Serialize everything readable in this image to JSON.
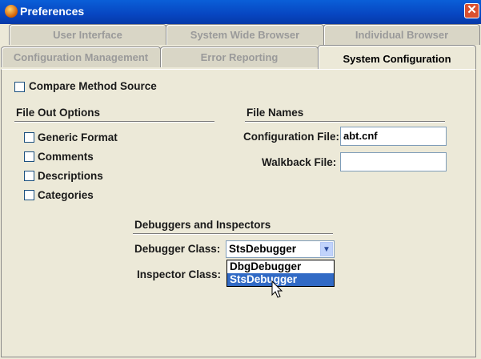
{
  "window": {
    "title": "Preferences",
    "close_symbol": "✕"
  },
  "tabs": {
    "row1": [
      "User Interface",
      "System Wide Browser",
      "Individual Browser"
    ],
    "row2": [
      "Configuration Management",
      "Error Reporting",
      "System Configuration"
    ]
  },
  "compare_method_source": {
    "label": "Compare Method Source",
    "checked": false
  },
  "file_out": {
    "title": "File Out Options",
    "options": [
      {
        "label": "Generic Format",
        "checked": false
      },
      {
        "label": "Comments",
        "checked": false
      },
      {
        "label": "Descriptions",
        "checked": false
      },
      {
        "label": "Categories",
        "checked": false
      }
    ]
  },
  "file_names": {
    "title": "File Names",
    "configuration_label": "Configuration File:",
    "configuration_value": "abt.cnf",
    "walkback_label": "Walkback File:",
    "walkback_value": ""
  },
  "debuggers": {
    "title": "Debuggers and Inspectors",
    "debugger_label": "Debugger Class:",
    "debugger_value": "StsDebugger",
    "inspector_label": "Inspector Class:",
    "options": [
      "DbgDebugger",
      "StsDebugger"
    ],
    "selected_option": "StsDebugger"
  }
}
